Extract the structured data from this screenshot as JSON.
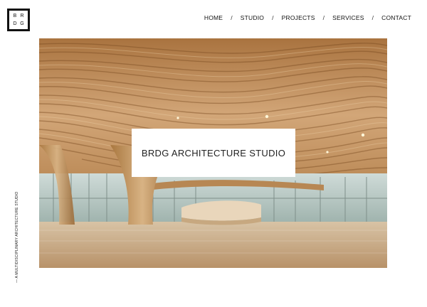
{
  "logo": {
    "letters": [
      "B",
      "R",
      "D",
      "G"
    ]
  },
  "nav": {
    "items": [
      {
        "label": "HOME"
      },
      {
        "label": "STUDIO"
      },
      {
        "label": "PROJECTS"
      },
      {
        "label": "SERVICES"
      },
      {
        "label": "CONTACT"
      }
    ],
    "separator": "/"
  },
  "hero": {
    "title": "BRDG ARCHITECTURE STUDIO",
    "image_subject": "curved-wood-ceiling-interior"
  },
  "tagline": "— A MULTIDISCIPLINARY ARCHITECTURE STUDIO",
  "colors": {
    "background": "#ffffff",
    "text": "#111111",
    "wood": "#c9a57a"
  }
}
